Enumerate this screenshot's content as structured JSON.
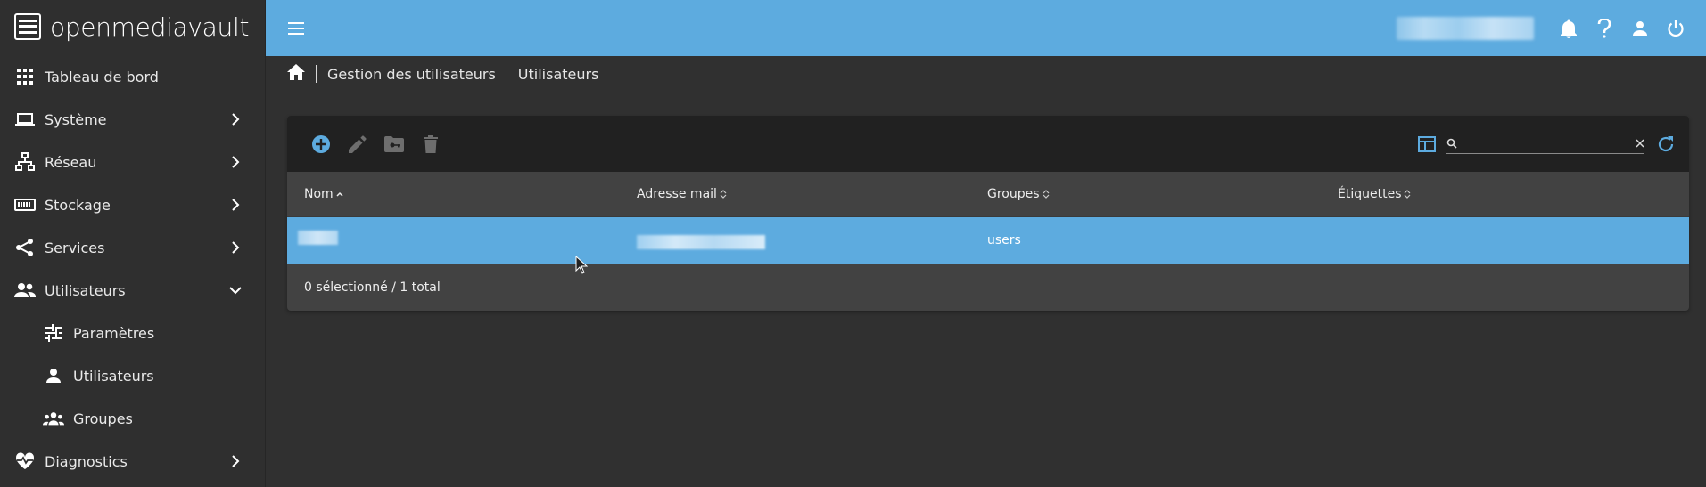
{
  "brand": {
    "name": "openmediavault"
  },
  "sidebar": {
    "items": [
      {
        "label": "Tableau de bord",
        "icon": "dashboard-grid-icon"
      },
      {
        "label": "Système",
        "icon": "laptop-icon"
      },
      {
        "label": "Réseau",
        "icon": "network-icon"
      },
      {
        "label": "Stockage",
        "icon": "storage-icon"
      },
      {
        "label": "Services",
        "icon": "share-icon"
      },
      {
        "label": "Utilisateurs",
        "icon": "people-icon",
        "expanded": true
      },
      {
        "label": "Paramètres",
        "icon": "sliders-icon"
      },
      {
        "label": "Utilisateurs",
        "icon": "person-icon"
      },
      {
        "label": "Groupes",
        "icon": "groups-icon"
      },
      {
        "label": "Diagnostics",
        "icon": "heart-pulse-icon"
      }
    ]
  },
  "breadcrumb": {
    "home_icon": "home-icon",
    "items": [
      "Gestion des utilisateurs",
      "Utilisateurs"
    ]
  },
  "table": {
    "columns": [
      "Nom",
      "Adresse mail",
      "Groupes",
      "Étiquettes"
    ],
    "sorted_column": "Nom",
    "rows": [
      {
        "nom": "",
        "adresse_mail": "",
        "groupes": "users",
        "etiquettes": "",
        "selected": true
      }
    ],
    "footer": "0 sélectionné / 1 total"
  },
  "search": {
    "value": "",
    "placeholder": ""
  },
  "colors": {
    "accent": "#5dabdf",
    "sidebar_bg": "#2f2f2f",
    "content_bg": "#303030",
    "card_bg": "#424242",
    "toolbar_bg": "#212121"
  }
}
